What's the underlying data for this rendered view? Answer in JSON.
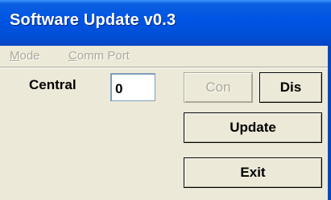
{
  "window": {
    "title": "Software Update v0.3"
  },
  "menu": {
    "items": [
      {
        "label_ul": "M",
        "label_rest": "ode"
      },
      {
        "label_ul": "C",
        "label_rest": "omm Port"
      }
    ]
  },
  "form": {
    "central_label": "Central",
    "central_value": "0"
  },
  "buttons": {
    "con_label": "Con",
    "dis_label": "Dis",
    "update_label": "Update",
    "exit_label": "Exit"
  },
  "colors": {
    "titlebar": "#0054e3",
    "face": "#ece9d8",
    "disabled_text": "#aca899"
  }
}
